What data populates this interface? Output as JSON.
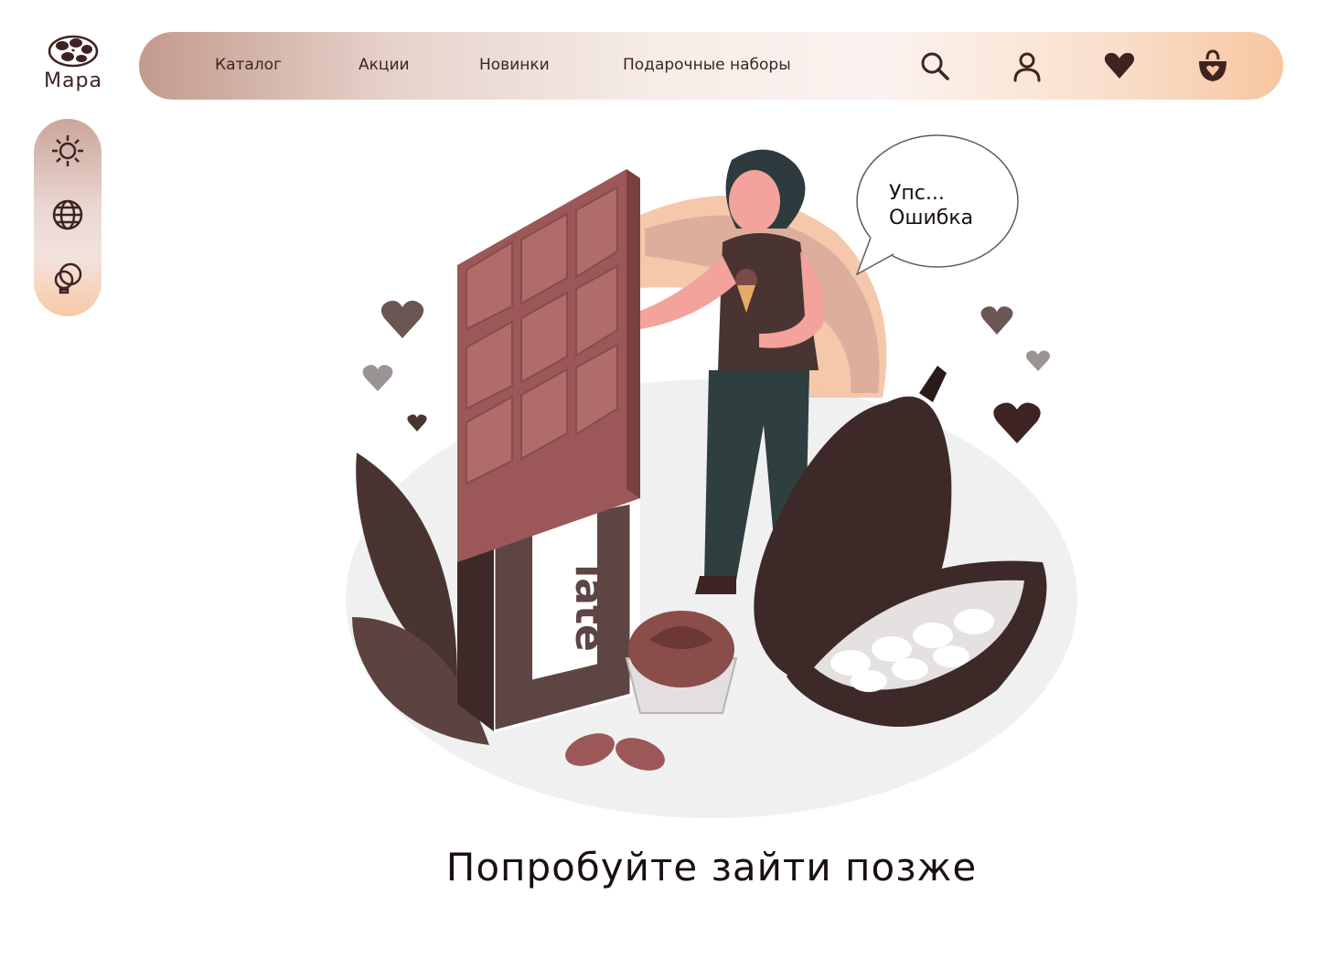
{
  "brand": {
    "name": "Мара",
    "logo_icon": "coffee-beans-icon"
  },
  "nav": {
    "items": [
      {
        "label": "Каталог"
      },
      {
        "label": "Акции"
      },
      {
        "label": "Новинки"
      },
      {
        "label": "Подарочные наборы"
      }
    ],
    "icons": [
      "search-icon",
      "user-icon",
      "heart-icon",
      "shopping-bag-icon"
    ]
  },
  "sidebar": {
    "icons": [
      "sun-icon",
      "globe-icon",
      "bulb-icon"
    ]
  },
  "illustration": {
    "speech_bubble": [
      "Упс...",
      "Ошибка"
    ],
    "wrapper_text": "late"
  },
  "message": "Попробуйте зайти позже",
  "colors": {
    "accent": "#f4a26a",
    "brown": "#3d2422",
    "chocolate": "#9c5858"
  }
}
